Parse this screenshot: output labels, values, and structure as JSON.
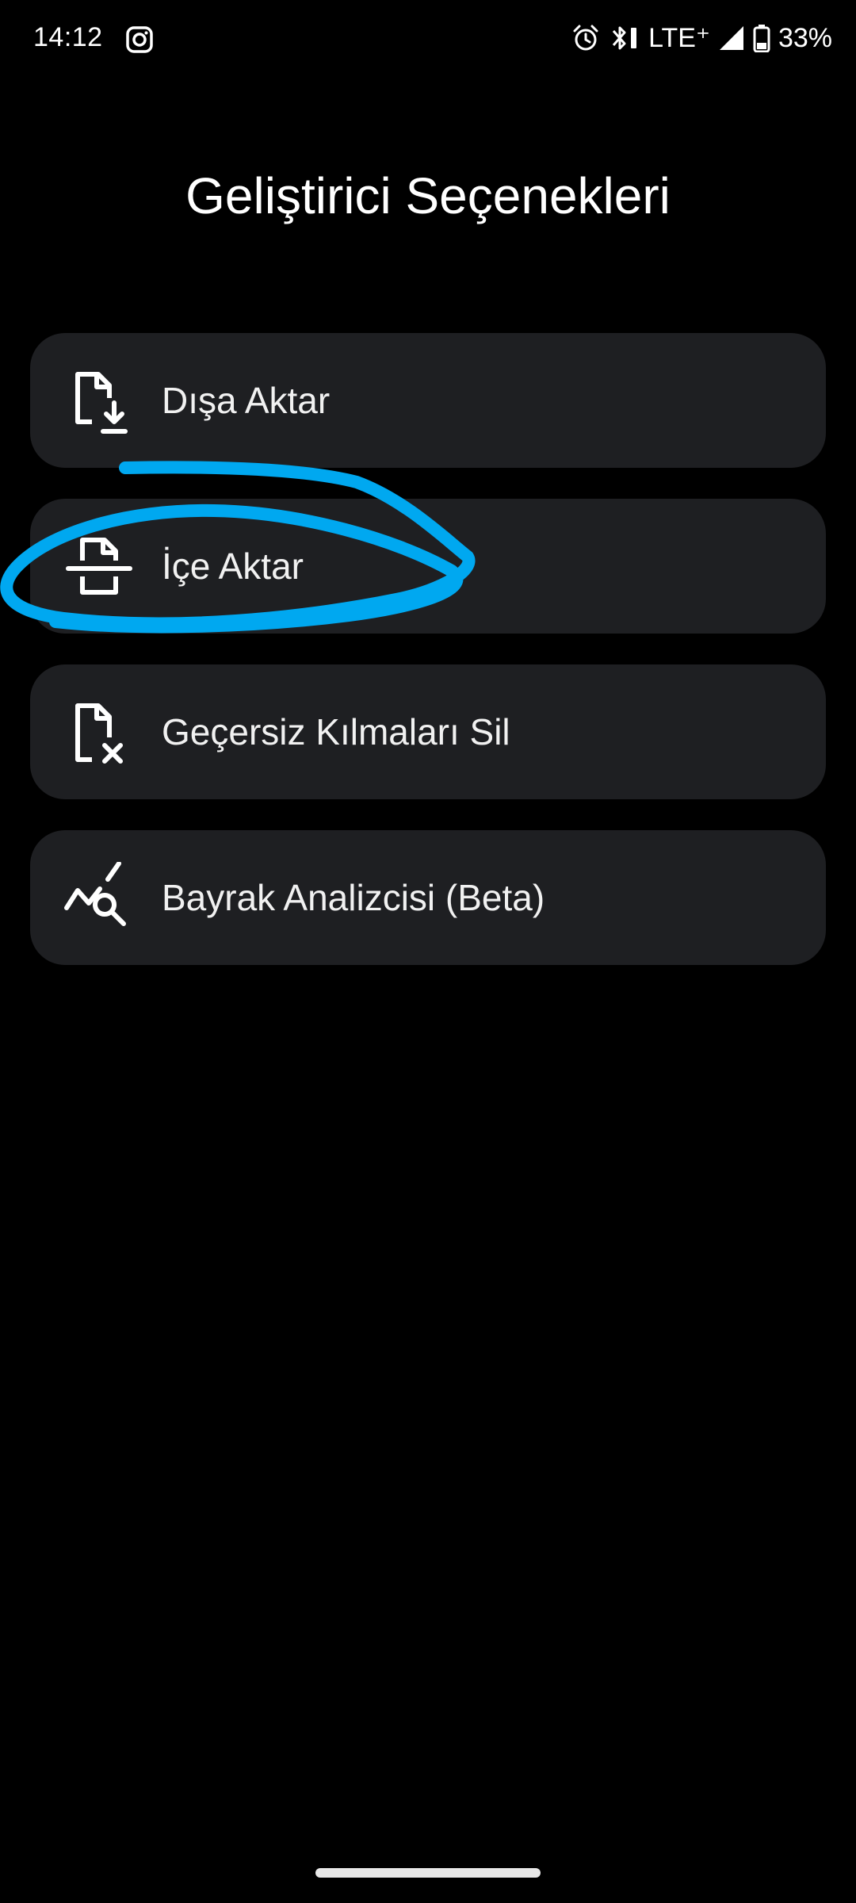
{
  "status_bar": {
    "time": "14:12",
    "network": "LTE⁺",
    "battery": "33%",
    "icons": [
      "instagram-icon",
      "alarm-icon",
      "bluetooth-icon",
      "signal-icon",
      "battery-icon"
    ]
  },
  "header": {
    "title": "Geliştirici Seçenekleri"
  },
  "menu": {
    "items": [
      {
        "label": "Dışa Aktar",
        "icon": "file-download-icon"
      },
      {
        "label": "İçe Aktar",
        "icon": "file-import-icon"
      },
      {
        "label": "Geçersiz Kılmaları Sil",
        "icon": "file-delete-icon"
      },
      {
        "label": "Bayrak Analizcisi (Beta)",
        "icon": "chart-search-icon"
      }
    ]
  },
  "colors": {
    "background": "#000000",
    "card": "#1e1f22",
    "text": "#ffffff",
    "annotation_stroke": "#00a8f0"
  }
}
